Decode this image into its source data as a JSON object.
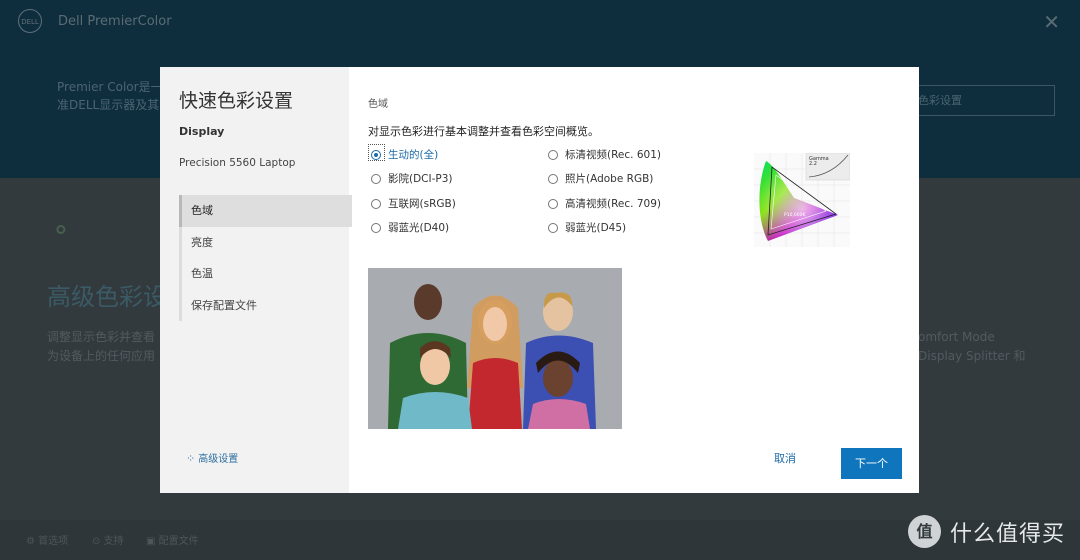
{
  "app": {
    "title": "Dell PremierColor",
    "logo_text": "DELL",
    "header_desc_line1": "Premier Color是一",
    "header_desc_line2": "准DELL显示器及其",
    "header_button": "色彩设置",
    "adv_title": "高级色彩设",
    "adv_desc_line1": "调整显示色彩并查看",
    "adv_desc_line2": "为设备上的任何应用",
    "right_line1": "omfort Mode",
    "right_line2": "Display Splitter 和",
    "footer": [
      "首选项",
      "支持",
      "配置文件"
    ]
  },
  "watermark": {
    "logo": "值",
    "text": "什么值得买"
  },
  "dialog": {
    "title": "快速色彩设置",
    "display_label": "Display",
    "device": "Precision 5560 Laptop",
    "nav": [
      {
        "label": "色域",
        "active": true
      },
      {
        "label": "亮度",
        "active": false
      },
      {
        "label": "色温",
        "active": false
      },
      {
        "label": "保存配置文件",
        "active": false
      }
    ],
    "advanced_link": "高级设置",
    "section_label": "色域",
    "instruction": "对显示色彩进行基本调整并查看色彩空间概览。",
    "options": [
      {
        "label": "生动的(全)",
        "selected": true
      },
      {
        "label": "影院(DCI-P3)",
        "selected": false
      },
      {
        "label": "互联网(sRGB)",
        "selected": false
      },
      {
        "label": "弱蓝光(D40)",
        "selected": false
      },
      {
        "label": "标清视频(Rec. 601)",
        "selected": false
      },
      {
        "label": "照片(Adobe RGB)",
        "selected": false
      },
      {
        "label": "高清视频(Rec. 709)",
        "selected": false
      },
      {
        "label": "弱蓝光(D45)",
        "selected": false
      }
    ],
    "gamut": {
      "gamma_label": "Gamma",
      "gamma_value": "2.2",
      "white_point": "P10,000K"
    },
    "photo_caption": "",
    "cancel_label": "取消",
    "next_label": "下一个",
    "colors": {
      "accent": "#0f76bd",
      "link": "#1e6ba7"
    }
  }
}
